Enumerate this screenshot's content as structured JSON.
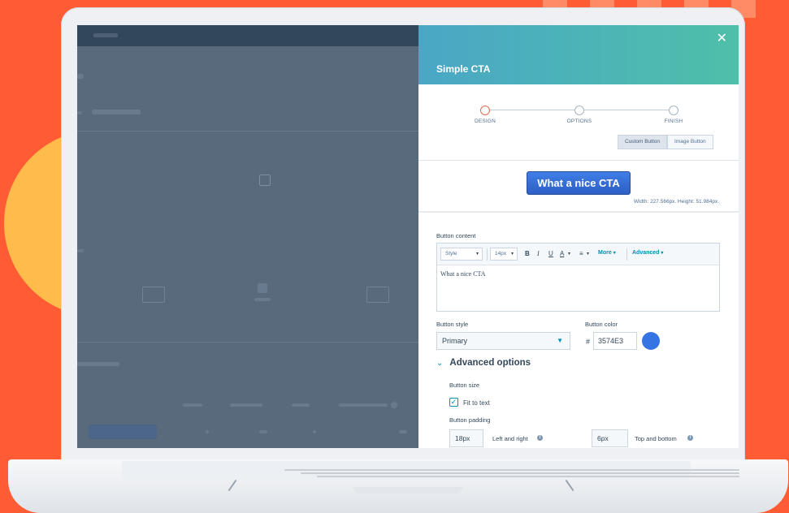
{
  "panel": {
    "title": "Simple CTA",
    "close_glyph": "✕"
  },
  "stepper": {
    "steps": [
      {
        "label": "DESIGN",
        "active": true
      },
      {
        "label": "OPTIONS",
        "active": false
      },
      {
        "label": "FINISH",
        "active": false
      }
    ]
  },
  "button_type": {
    "options": [
      "Custom Button",
      "Image Button"
    ],
    "selected": "Custom Button"
  },
  "preview": {
    "cta_text": "What a nice CTA",
    "dimensions": "Width: 227.566px. Height: 51.984px."
  },
  "button_content": {
    "label": "Button content",
    "toolbar": {
      "style": "Style",
      "font_size": "14px",
      "bold": "B",
      "italic": "I",
      "underline": "U",
      "text_color": "A",
      "align": "≡",
      "more": "More",
      "advanced": "Advanced"
    },
    "value": "What a nice CTA"
  },
  "button_style": {
    "label": "Button style",
    "value": "Primary"
  },
  "button_color": {
    "label": "Button color",
    "hash": "#",
    "value": "3574E3",
    "swatch": "#3574E3"
  },
  "advanced": {
    "title": "Advanced options",
    "button_size_label": "Button size",
    "fit_to_text": {
      "label": "Fit to text",
      "checked": true
    },
    "padding_label": "Button padding",
    "left_right": {
      "value": "18px",
      "label": "Left and right"
    },
    "top_bottom": {
      "value": "6px",
      "label": "Top and bottom"
    }
  },
  "colors": {
    "background": "#ff5c35",
    "accent_circle": "#ffbc4a",
    "header_gradient_start": "#4aa7c6",
    "header_gradient_end": "#4fbfa9",
    "link": "#0091ae"
  }
}
